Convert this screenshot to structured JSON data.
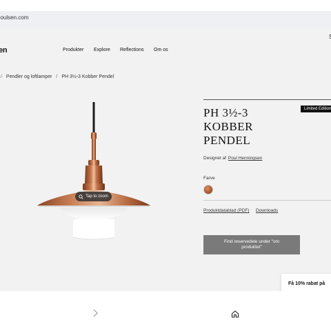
{
  "browser": {
    "url": "poulsen.com"
  },
  "header": {
    "logo": "en",
    "nav": [
      "Produkter",
      "Explore",
      "Reflections",
      "Om os"
    ],
    "right_glyph": "S"
  },
  "breadcrumb": [
    "/",
    "Pendler og loftlamper",
    "/",
    "PH 3½-3 Kobber Pendel"
  ],
  "gallery": {
    "zoom_label": "Tap to zoom"
  },
  "product": {
    "badge": "Limited Edition",
    "title_lines": [
      "PH 3½-3",
      "KOBBER",
      "PENDEL"
    ],
    "designer_prefix": "Designet af",
    "designer_name": "Poul Henningsen",
    "color_label": "Farve",
    "color_swatch": "#b8673a",
    "pdf_link": "Produktdatablad (PDF)",
    "downloads_link": "Downloads",
    "cta": "Find reservedele under \"om produktet\""
  },
  "promo": {
    "text": "Få 10% rabat på"
  },
  "bottom_nav": {
    "back_icon": "chevron-right-icon",
    "home_icon": "home-icon"
  }
}
